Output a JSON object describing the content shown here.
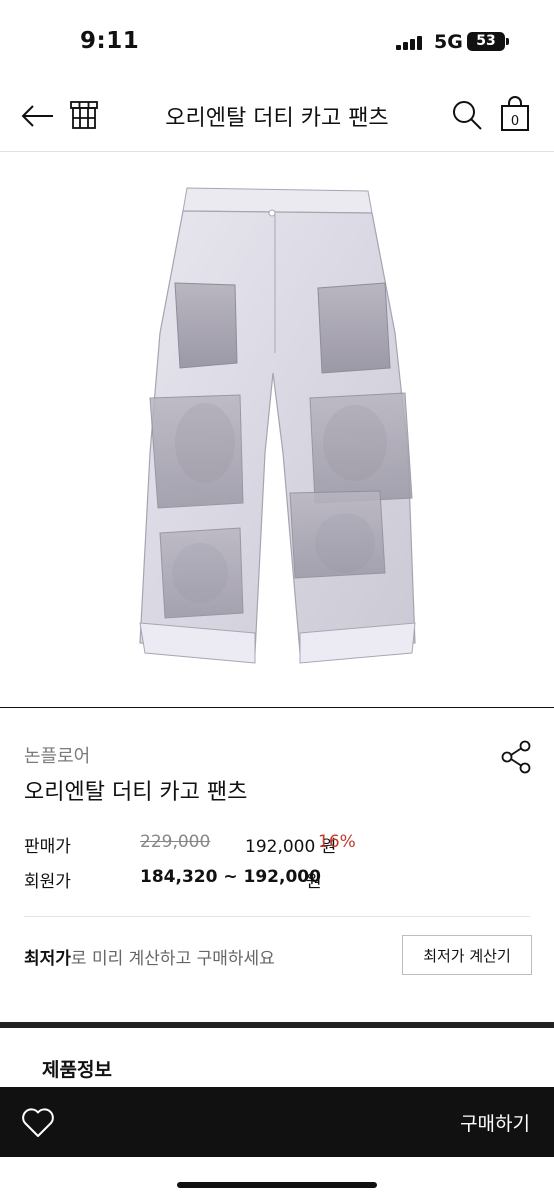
{
  "status": {
    "time": "9:11",
    "network": "5G",
    "battery": "53"
  },
  "header": {
    "title": "오리엔탈 더티 카고 팬츠",
    "cart_count": "0"
  },
  "icons": {
    "back": "back-arrow-icon",
    "store": "store-icon",
    "search": "search-icon",
    "cart": "shopping-bag-icon",
    "share": "share-icon",
    "wishlist": "heart-icon"
  },
  "product": {
    "brand": "논플로어",
    "name": "오리엔탈 더티 카고 팬츠",
    "price_label": "판매가",
    "original_price": "229,000",
    "sale_price": "192,000 원",
    "discount": "16%",
    "member_label": "회원가",
    "member_price": "184,320 ~ 192,000",
    "member_unit": "원"
  },
  "lowest": {
    "emphasis": "최저가",
    "text": "로 미리 계산하고 구매하세요",
    "button": "최저가 계산기"
  },
  "section": {
    "title": "제품정보"
  },
  "bottom": {
    "buy_label": "구매하기"
  },
  "colors": {
    "discount": "#c0392b",
    "bar": "#111111"
  }
}
